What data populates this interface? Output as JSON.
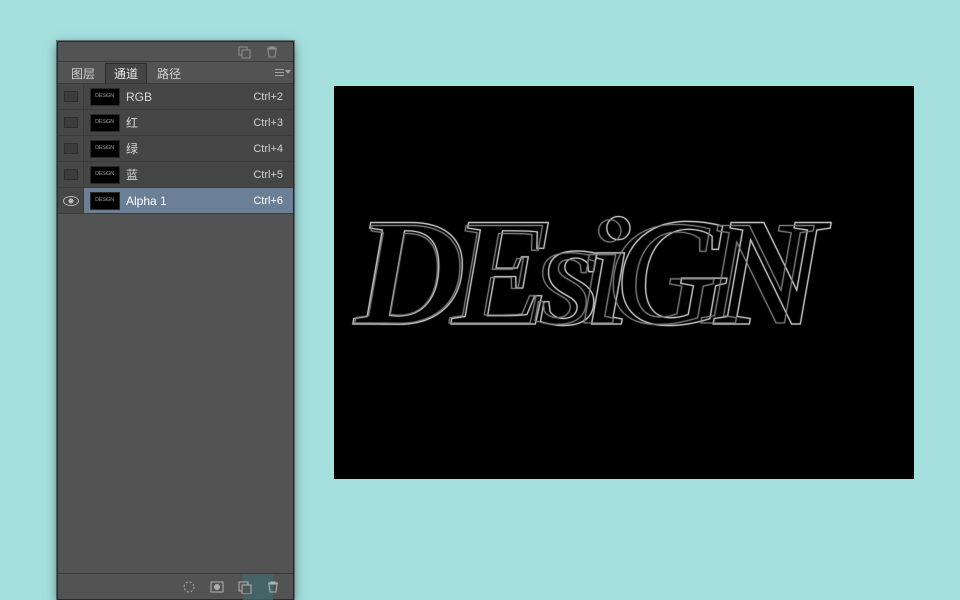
{
  "tabs": {
    "layers": "图层",
    "channels": "通道",
    "paths": "路径"
  },
  "channels": [
    {
      "name": "RGB",
      "shortcut": "Ctrl+2",
      "visible": false,
      "selected": false
    },
    {
      "name": "红",
      "shortcut": "Ctrl+3",
      "visible": false,
      "selected": false
    },
    {
      "name": "绿",
      "shortcut": "Ctrl+4",
      "visible": false,
      "selected": false
    },
    {
      "name": "蓝",
      "shortcut": "Ctrl+5",
      "visible": false,
      "selected": false
    },
    {
      "name": "Alpha 1",
      "shortcut": "Ctrl+6",
      "visible": true,
      "selected": true
    }
  ],
  "icons": {
    "overlap_squares": "overlap-squares-icon",
    "trash": "trash-icon",
    "load_selection": "load-selection-icon",
    "save_selection": "save-selection-icon",
    "new_channel": "new-channel-icon"
  },
  "canvas_artwork": "DEsiGN"
}
